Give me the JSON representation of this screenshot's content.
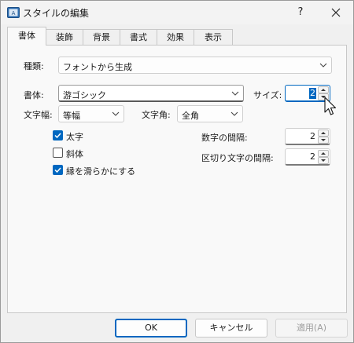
{
  "window": {
    "title": "スタイルの編集",
    "help_label": "?"
  },
  "tabs": [
    {
      "label": "書体",
      "active": true
    },
    {
      "label": "装飾"
    },
    {
      "label": "背景"
    },
    {
      "label": "書式"
    },
    {
      "label": "効果"
    },
    {
      "label": "表示"
    }
  ],
  "form": {
    "kind_label": "種類:",
    "kind_value": "フォントから生成",
    "font_label": "書体:",
    "font_value": "游ゴシック",
    "size_label": "サイズ:",
    "size_value": "2",
    "width_label": "文字幅:",
    "width_value": "等幅",
    "angle_label": "文字角:",
    "angle_value": "全角",
    "bold_label": "太字",
    "bold_checked": true,
    "italic_label": "斜体",
    "italic_checked": false,
    "smooth_label": "縁を滑らかにする",
    "smooth_checked": true,
    "digit_spacing_label": "数字の間隔:",
    "digit_spacing_value": "2",
    "delim_spacing_label": "区切り文字の間隔:",
    "delim_spacing_value": "2"
  },
  "buttons": {
    "ok": "OK",
    "cancel": "キャンセル",
    "apply": "適用(A)"
  },
  "colors": {
    "accent": "#0067c0",
    "panel": "#f9f9f9",
    "dialog": "#f0f0f0"
  }
}
